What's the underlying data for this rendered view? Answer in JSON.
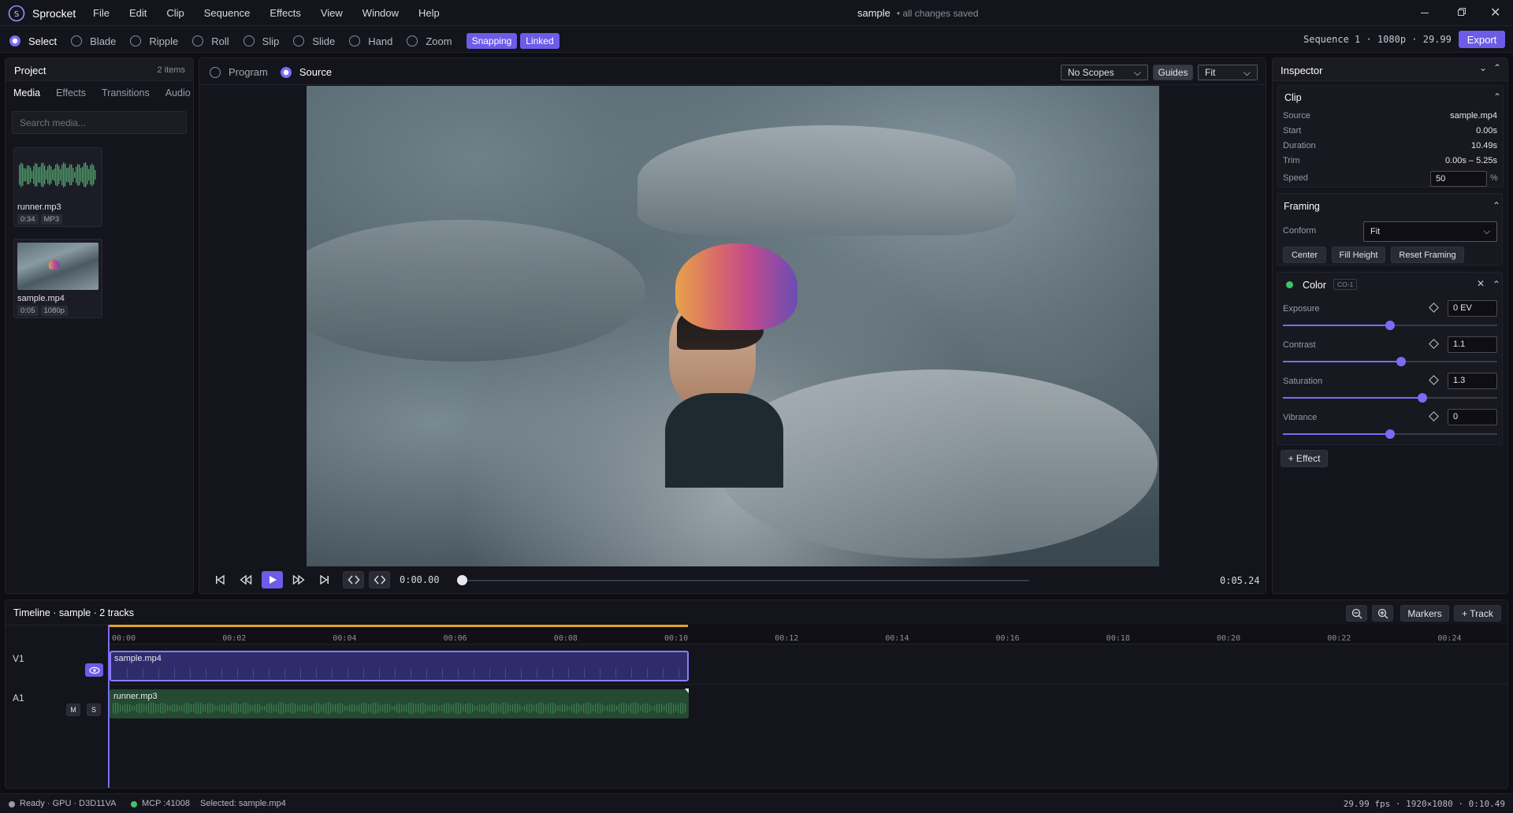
{
  "app": {
    "name": "Sprocket",
    "doc_title": "sample",
    "save_status": "• all changes saved"
  },
  "menu": [
    "File",
    "Edit",
    "Clip",
    "Sequence",
    "Effects",
    "View",
    "Window",
    "Help"
  ],
  "tools": [
    {
      "label": "Select",
      "active": true
    },
    {
      "label": "Blade"
    },
    {
      "label": "Ripple"
    },
    {
      "label": "Roll"
    },
    {
      "label": "Slip"
    },
    {
      "label": "Slide"
    },
    {
      "label": "Hand"
    },
    {
      "label": "Zoom"
    }
  ],
  "toggles": {
    "snapping": "Snapping",
    "linked": "Linked"
  },
  "sequence_info": "Sequence 1 · 1080p · 29.99",
  "export_label": "Export",
  "project": {
    "title": "Project",
    "count": "2 items",
    "tabs": [
      "Media",
      "Effects",
      "Transitions",
      "Audio"
    ],
    "search_placeholder": "Search media...",
    "items": [
      {
        "name": "runner.mp3",
        "duration": "0:34",
        "tag": "MP3"
      },
      {
        "name": "sample.mp4",
        "duration": "0:05",
        "tag": "1080p"
      }
    ]
  },
  "viewer": {
    "program": "Program",
    "source": "Source",
    "scopes": "No Scopes",
    "guides": "Guides",
    "fit": "Fit",
    "timecode": "0:00.00",
    "duration": "0:05.24",
    "progress": 0
  },
  "inspector": {
    "title": "Inspector",
    "clip": {
      "title": "Clip",
      "rows": [
        {
          "label": "Source",
          "value": "sample.mp4"
        },
        {
          "label": "Start",
          "value": "0.00s"
        },
        {
          "label": "Duration",
          "value": "10.49s"
        },
        {
          "label": "Trim",
          "value": "0.00s – 5.25s"
        }
      ],
      "speed_label": "Speed",
      "speed": "50",
      "speed_unit": "%"
    },
    "framing": {
      "title": "Framing",
      "conform_label": "Conform",
      "conform": "Fit",
      "buttons": [
        "Center",
        "Fill Height",
        "Reset Framing"
      ]
    },
    "color": {
      "title": "Color",
      "badge": "CO-1",
      "params": [
        {
          "label": "Exposure",
          "value": "0 EV",
          "level": 0.5
        },
        {
          "label": "Contrast",
          "value": "1.1",
          "level": 0.55
        },
        {
          "label": "Saturation",
          "value": "1.3",
          "level": 0.65
        },
        {
          "label": "Vibrance",
          "value": "0",
          "level": 0.5
        }
      ]
    },
    "add_effect": "+ Effect"
  },
  "timeline": {
    "title": "Timeline · sample · 2 tracks",
    "markers": "Markers",
    "add_track": "+ Track",
    "ticks": [
      "00:00",
      "00:02",
      "00:04",
      "00:06",
      "00:08",
      "00:10",
      "00:12",
      "00:14",
      "00:16",
      "00:18",
      "00:20",
      "00:22",
      "00:24"
    ],
    "tracks": [
      {
        "name": "V1",
        "clip": "sample.mp4"
      },
      {
        "name": "A1",
        "clip": "runner.mp3",
        "mute": "M",
        "solo": "S"
      }
    ]
  },
  "status": {
    "ready": "Ready · GPU · D3D11VA",
    "mcp": "MCP :41008",
    "selected": "Selected: sample.mp4",
    "right": "29.99 fps · 1920×1080 · 0:10.49"
  },
  "colors": {
    "accent": "#6d5ce8",
    "audio_clip": "#244a32",
    "video_clip": "#2e2c6a",
    "playhead_range": "#e0a526"
  }
}
